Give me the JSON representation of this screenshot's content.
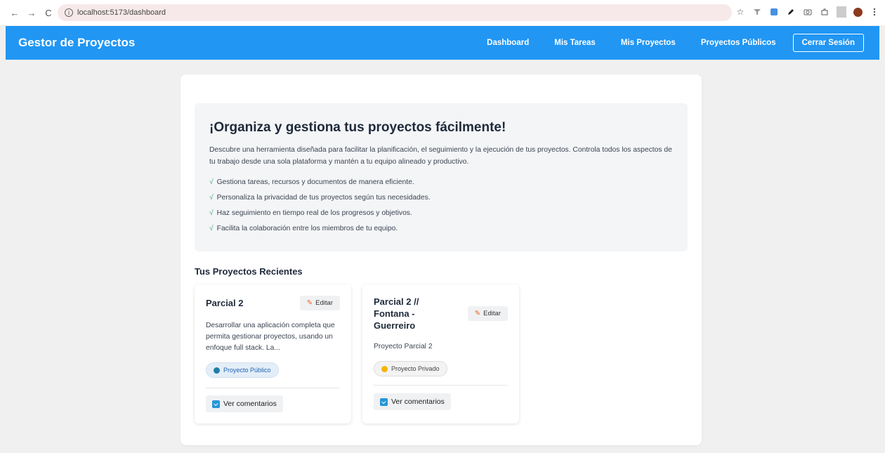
{
  "browser": {
    "url": "localhost:5173/dashboard",
    "back_glyph": "←",
    "forward_glyph": "→",
    "reload_glyph": "C",
    "info_glyph": "i",
    "star_glyph": "☆"
  },
  "header": {
    "brand": "Gestor de Proyectos",
    "nav": [
      "Dashboard",
      "Mis Tareas",
      "Mis Proyectos",
      "Proyectos Públicos"
    ],
    "logout": "Cerrar Sesión",
    "color": "#2196f3"
  },
  "hero": {
    "title": "¡Organiza y gestiona tus proyectos fácilmente!",
    "description": "Descubre una herramienta diseñada para facilitar la planificación, el seguimiento y la ejecución de tus proyectos. Controla todos los aspectos de tu trabajo desde una sola plataforma y mantén a tu equipo alineado y productivo.",
    "check_glyph": "√",
    "features": [
      "Gestiona tareas, recursos y documentos de manera eficiente.",
      "Personaliza la privacidad de tus proyectos según tus necesidades.",
      "Haz seguimiento en tiempo real de los progresos y objetivos.",
      "Facilita la colaboración entre los miembros de tu equipo."
    ]
  },
  "recent": {
    "title": "Tus Proyectos Recientes",
    "edit_label": "Editar",
    "comments_label": "Ver comentarios",
    "projects": [
      {
        "title": "Parcial 2",
        "description": "Desarrollar una aplicación completa que permita gestionar proyectos, usando un enfoque full stack. La...",
        "badge": "Proyecto Público",
        "visibility": "public"
      },
      {
        "title": "Parcial 2 // Fontana - Guerreiro",
        "description": "Proyecto Parcial 2",
        "badge": "Proyecto Privado",
        "visibility": "private"
      }
    ]
  }
}
